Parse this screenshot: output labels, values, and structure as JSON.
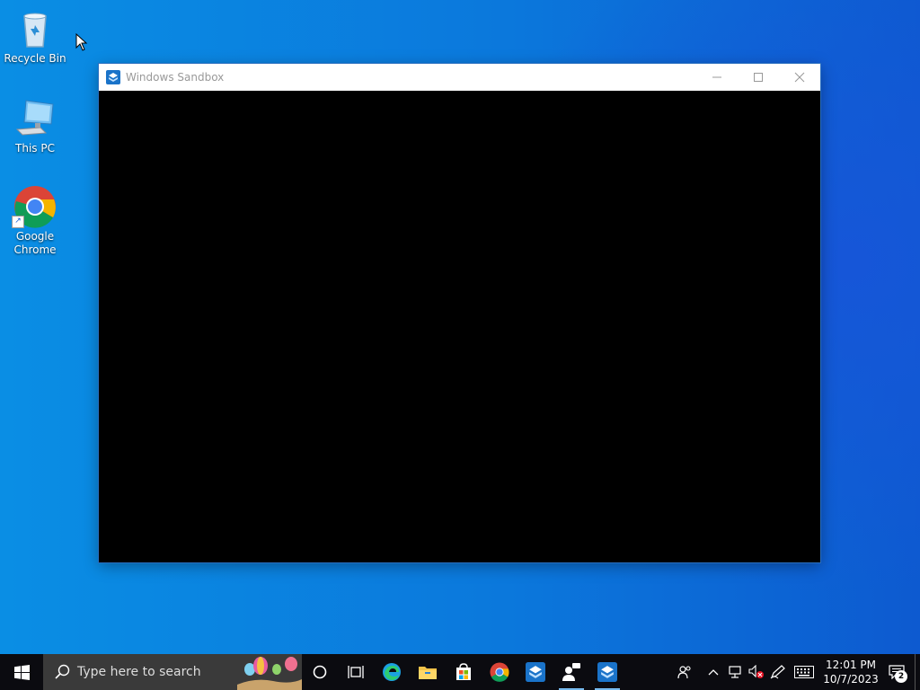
{
  "desktop": {
    "icons": [
      {
        "label": "Recycle Bin"
      },
      {
        "label": "This PC"
      },
      {
        "label": "Google Chrome"
      }
    ]
  },
  "window": {
    "title": "Windows Sandbox"
  },
  "taskbar": {
    "search_placeholder": "Type here to search",
    "pinned": [
      "Cortana",
      "Task View",
      "Microsoft Edge",
      "File Explorer",
      "Microsoft Store",
      "Google Chrome",
      "Windows Sandbox",
      "Feedback Hub",
      "Windows Sandbox"
    ],
    "clock_time": "12:01 PM",
    "clock_date": "10/7/2023",
    "notification_count": "2"
  },
  "colors": {
    "accent": "#0078d7",
    "taskbar": "#0b0b10",
    "search_box": "#3a3a3a"
  }
}
